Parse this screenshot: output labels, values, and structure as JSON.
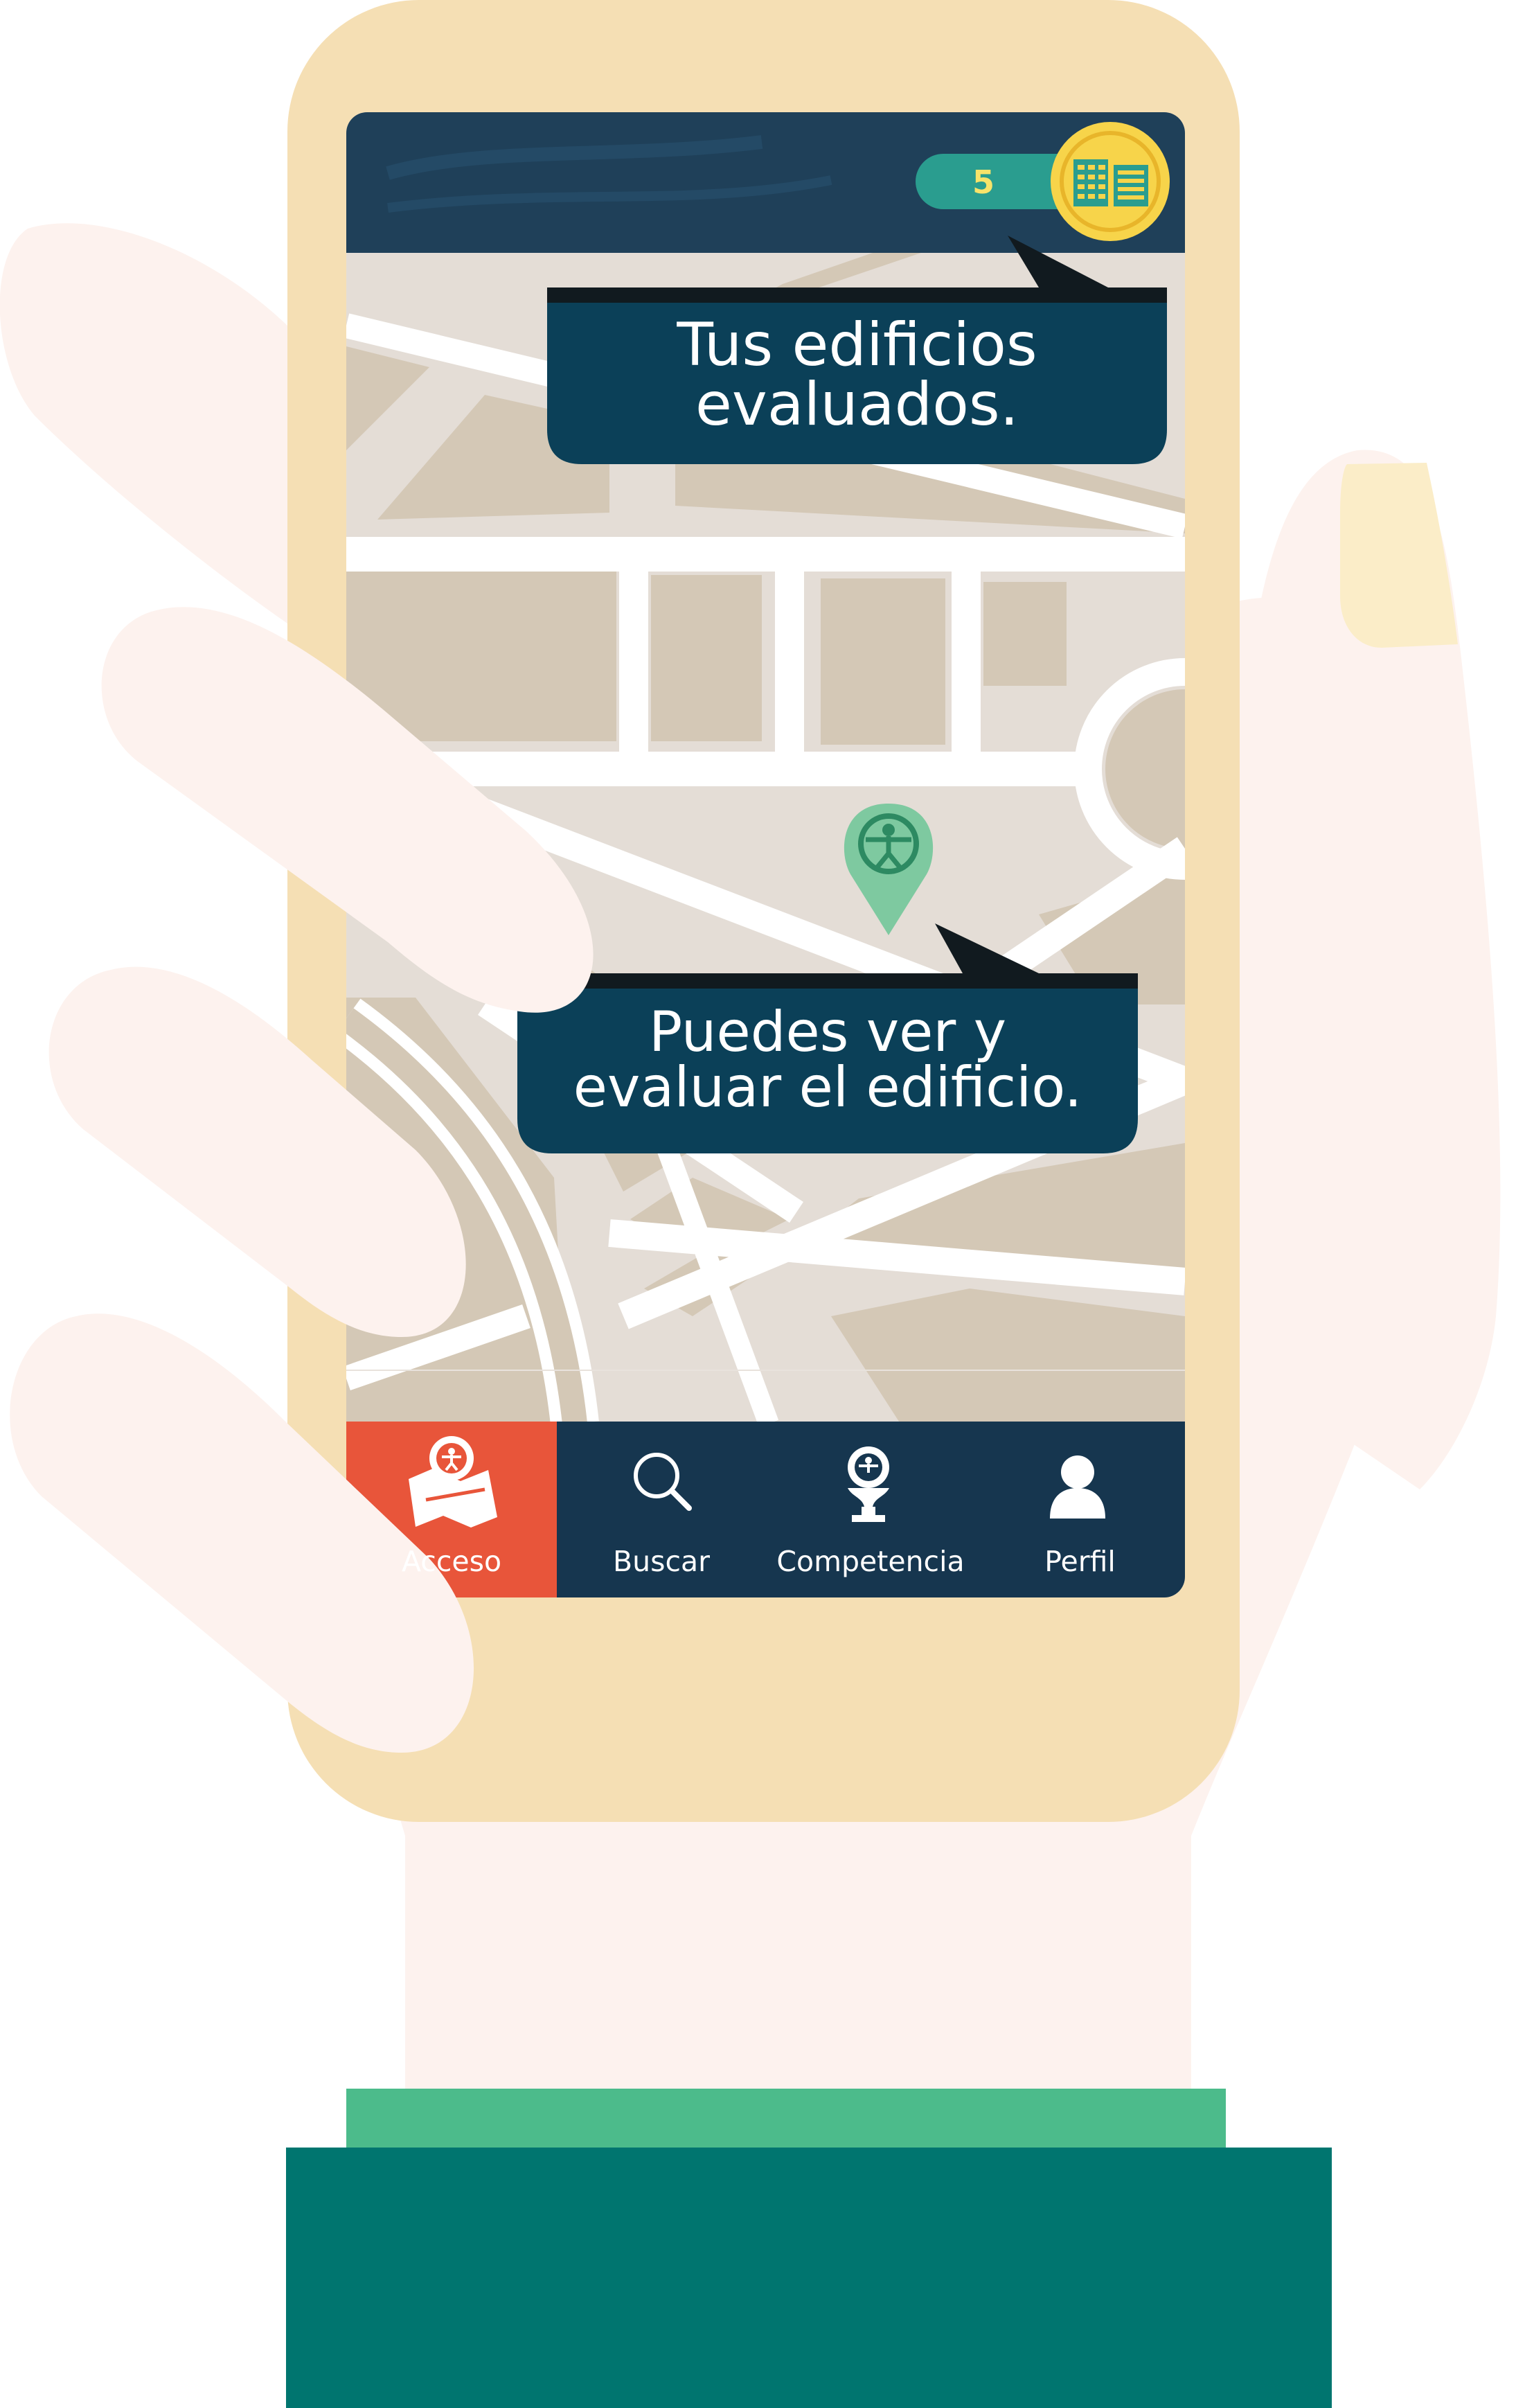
{
  "header": {
    "evaluated_count": "5",
    "counter_icon": "building-icon"
  },
  "tooltips": {
    "evaluated": [
      "Tus edificios",
      "evaluados."
    ],
    "building": [
      "Puedes ver y",
      "evaluar el edificio."
    ]
  },
  "map": {
    "marker_icon": "accessibility-pin-icon"
  },
  "nav": {
    "items": [
      {
        "label": "Acceso",
        "icon": "map-accessibility-icon",
        "active": true
      },
      {
        "label": "Buscar",
        "icon": "search-icon",
        "active": false
      },
      {
        "label": "Competencia",
        "icon": "trophy-icon",
        "active": false
      },
      {
        "label": "Perfil",
        "icon": "user-icon",
        "active": false
      }
    ]
  },
  "colors": {
    "phone_body": "#f5dfb4",
    "header_bg": "#1f4059",
    "nav_bg": "#16364f",
    "nav_active": "#e8553a",
    "tooltip_bg": "#0b4058",
    "counter_pill": "#2a9d8f",
    "coin": "#f7d44a",
    "hand": "#fdf2ee",
    "sleeve": "#00756f",
    "cuff": "#4cbb8b",
    "map_bg": "#e4ddd6",
    "map_block": "#d4c8b6",
    "marker": "#7ec9a0"
  }
}
